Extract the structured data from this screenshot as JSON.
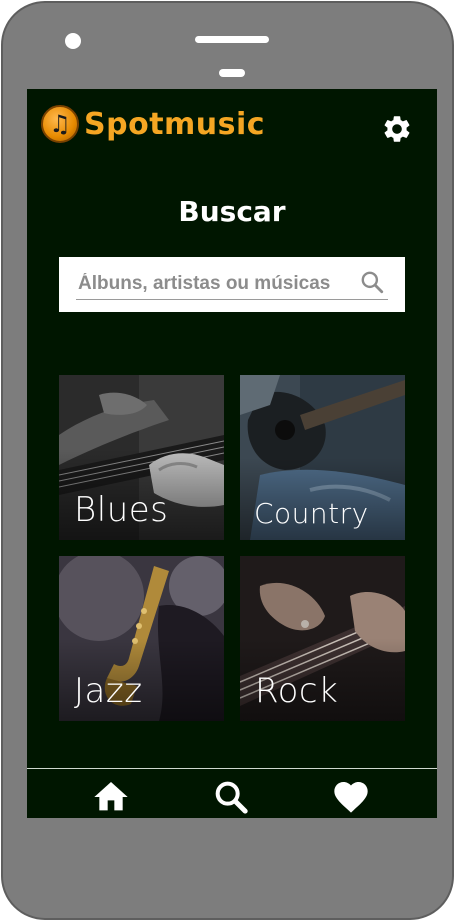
{
  "app": {
    "name": "Spotmusic",
    "logo_icon": "music-note-icon",
    "settings_icon": "gear-icon"
  },
  "page": {
    "title": "Buscar"
  },
  "search": {
    "placeholder": "Álbuns, artistas ou músicas",
    "value": "",
    "icon": "search-icon"
  },
  "genres": [
    {
      "label": "Blues"
    },
    {
      "label": "Country"
    },
    {
      "label": "Jazz"
    },
    {
      "label": "Rock"
    }
  ],
  "bottom_nav": [
    {
      "name": "home",
      "icon": "home-icon"
    },
    {
      "name": "search",
      "icon": "search-icon"
    },
    {
      "name": "favorites",
      "icon": "heart-icon"
    }
  ],
  "colors": {
    "screen_bg": "#001600",
    "brand": "#f5a623",
    "phone_body": "#7d7d7d"
  }
}
